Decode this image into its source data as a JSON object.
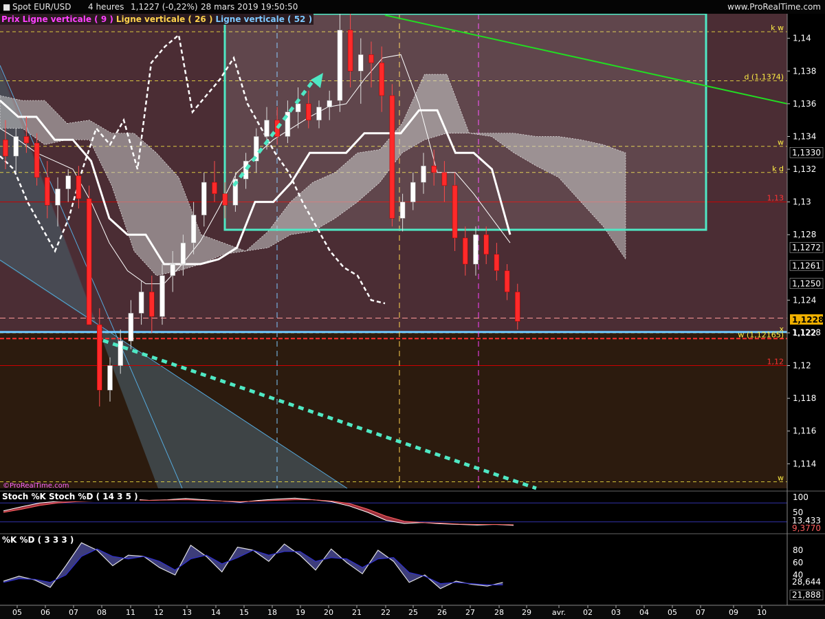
{
  "header": {
    "symbol": "Spot EUR/USD",
    "period": "4 heures",
    "last": "1,1227 (-0,22%)",
    "datetime": "28 mars 2019 19:50:50",
    "site": "www.ProRealTime.com"
  },
  "legend": {
    "price": "Prix",
    "line9": "Ligne verticale ( 9 )",
    "line26": "Ligne verticale ( 26 )",
    "line52": "Ligne verticale ( 52 )",
    "colors": {
      "price": "#ff40ff",
      "line9": "#ff40ff",
      "line26": "#ffd24d",
      "line52": "#7ec8ff"
    }
  },
  "watermark": "©ProRealTime.com",
  "colors": {
    "upCandle": "#ffffff",
    "downCandle": "#ff2a2a",
    "cloud": "#c8c8c8",
    "kijun": "#ffffff",
    "chikou": "#ffffff",
    "box": "#4fe8c4",
    "trendGreen": "#22dd22",
    "trendDotted": "#4fe8c4",
    "channel": "#55aadd",
    "support": "#6fc8ff",
    "resistanceRed": "#cc0000",
    "yellowDash": "#ffee44"
  },
  "chart_data": [
    {
      "type": "line",
      "panel": "price",
      "title": "Spot EUR/USD 4 heures",
      "x_ticks": [
        "05",
        "06",
        "07",
        "08",
        "11",
        "12",
        "13",
        "14",
        "15",
        "18",
        "19",
        "20",
        "21",
        "22",
        "25",
        "26",
        "27",
        "28",
        "29",
        "avr.",
        "02",
        "03",
        "04",
        "05",
        "07",
        "09",
        "10"
      ],
      "y_ticks": [
        "1,14",
        "1,138",
        "1,136",
        "1,134",
        "1,132",
        "1,13",
        "1,128",
        "1,124",
        "1,122",
        "1,12",
        "1,118",
        "1,116",
        "1,114"
      ],
      "ylim": [
        1.1125,
        1.1415
      ],
      "price_tags": [
        "1,1330",
        "1,1272",
        "1,1261",
        "1,1250",
        "1,1228",
        "1,1228"
      ],
      "last_price": "1,1228",
      "level_labels": [
        {
          "text": "k w",
          "value": 1.1404,
          "color": "#ffee44"
        },
        {
          "text": "d (1,1374)",
          "value": 1.1374,
          "color": "#ffee44"
        },
        {
          "text": "w",
          "value": 1.1334,
          "color": "#ffee44"
        },
        {
          "text": "k d",
          "value": 1.1318,
          "color": "#ffee44"
        },
        {
          "text": "1,13",
          "value": 1.13,
          "color": "#ff3333"
        },
        {
          "text": "x",
          "value": 1.122,
          "color": "#ffee44"
        },
        {
          "text": "w (1,12165)",
          "value": 1.12165,
          "color": "#ffee44"
        },
        {
          "text": "1,12",
          "value": 1.12,
          "color": "#ff3333"
        },
        {
          "text": "w",
          "value": 1.1129,
          "color": "#ffee44"
        }
      ],
      "vertical_lines": [
        {
          "name": "Ligne verticale ( 9 )",
          "x": "27 (late)",
          "color": "#ff40ff"
        },
        {
          "name": "Ligne verticale ( 26 )",
          "x": "22 (late)",
          "color": "#ffd24d"
        },
        {
          "name": "Ligne verticale ( 52 )",
          "x": "18",
          "color": "#7ec8ff"
        }
      ],
      "candles": [
        [
          1.1338,
          1.135,
          1.132,
          1.1328
        ],
        [
          1.1328,
          1.1345,
          1.1318,
          1.134
        ],
        [
          1.134,
          1.1352,
          1.133,
          1.1336
        ],
        [
          1.1336,
          1.1342,
          1.131,
          1.1315
        ],
        [
          1.1315,
          1.1325,
          1.129,
          1.1298
        ],
        [
          1.1298,
          1.1315,
          1.1285,
          1.1308
        ],
        [
          1.1308,
          1.132,
          1.13,
          1.1316
        ],
        [
          1.1316,
          1.1322,
          1.1296,
          1.1302
        ],
        [
          1.1302,
          1.131,
          1.124,
          1.1225
        ],
        [
          1.1225,
          1.1235,
          1.1175,
          1.1185
        ],
        [
          1.1185,
          1.1205,
          1.1178,
          1.12
        ],
        [
          1.12,
          1.1222,
          1.1195,
          1.1215
        ],
        [
          1.1215,
          1.124,
          1.121,
          1.1232
        ],
        [
          1.1232,
          1.1252,
          1.1225,
          1.1245
        ],
        [
          1.1245,
          1.1255,
          1.122,
          1.123
        ],
        [
          1.123,
          1.1262,
          1.1225,
          1.1255
        ],
        [
          1.1255,
          1.127,
          1.1245,
          1.1262
        ],
        [
          1.1262,
          1.128,
          1.1255,
          1.1275
        ],
        [
          1.1275,
          1.13,
          1.1268,
          1.1292
        ],
        [
          1.1292,
          1.1318,
          1.1285,
          1.1312
        ],
        [
          1.1312,
          1.1325,
          1.13,
          1.1305
        ],
        [
          1.1305,
          1.1312,
          1.129,
          1.1298
        ],
        [
          1.1298,
          1.1318,
          1.1294,
          1.1314
        ],
        [
          1.1314,
          1.133,
          1.1308,
          1.1325
        ],
        [
          1.1325,
          1.1345,
          1.1318,
          1.134
        ],
        [
          1.134,
          1.1358,
          1.1332,
          1.135
        ],
        [
          1.135,
          1.1358,
          1.1335,
          1.134
        ],
        [
          1.134,
          1.1362,
          1.1336,
          1.1355
        ],
        [
          1.1355,
          1.137,
          1.1345,
          1.136
        ],
        [
          1.136,
          1.1368,
          1.1345,
          1.135
        ],
        [
          1.135,
          1.1362,
          1.1345,
          1.1358
        ],
        [
          1.1358,
          1.1368,
          1.135,
          1.1362
        ],
        [
          1.1362,
          1.1418,
          1.1355,
          1.1405
        ],
        [
          1.1405,
          1.142,
          1.137,
          1.138
        ],
        [
          1.138,
          1.14,
          1.136,
          1.139
        ],
        [
          1.139,
          1.1398,
          1.137,
          1.1385
        ],
        [
          1.1385,
          1.1395,
          1.1355,
          1.1365
        ],
        [
          1.1365,
          1.1372,
          1.1285,
          1.129
        ],
        [
          1.129,
          1.1305,
          1.1282,
          1.13
        ],
        [
          1.13,
          1.1318,
          1.1295,
          1.1312
        ],
        [
          1.1312,
          1.133,
          1.1305,
          1.1322
        ],
        [
          1.1322,
          1.1332,
          1.131,
          1.1318
        ],
        [
          1.1318,
          1.1325,
          1.13,
          1.131
        ],
        [
          1.131,
          1.1318,
          1.127,
          1.1278
        ],
        [
          1.1278,
          1.1285,
          1.1255,
          1.1262
        ],
        [
          1.1262,
          1.1285,
          1.1255,
          1.128
        ],
        [
          1.128,
          1.1285,
          1.1262,
          1.1268
        ],
        [
          1.1268,
          1.1275,
          1.1252,
          1.1258
        ],
        [
          1.1258,
          1.1262,
          1.124,
          1.1245
        ],
        [
          1.1245,
          1.125,
          1.1222,
          1.1227
        ]
      ],
      "ichimoku": {
        "kijun": [
          1.1362,
          1.1352,
          1.1352,
          1.1338,
          1.1338,
          1.1325,
          1.129,
          1.128,
          1.128,
          1.1262,
          1.1262,
          1.1262,
          1.1265,
          1.1272,
          1.13,
          1.13,
          1.1312,
          1.133,
          1.133,
          1.133,
          1.1342,
          1.1342,
          1.1342,
          1.1356,
          1.1356,
          1.133,
          1.133,
          1.132,
          1.128
        ],
        "tenkan": [
          1.1345,
          1.1338,
          1.133,
          1.1325,
          1.132,
          1.13,
          1.1275,
          1.1258,
          1.125,
          1.125,
          1.1262,
          1.1276,
          1.1296,
          1.1318,
          1.1328,
          1.1338,
          1.1345,
          1.1352,
          1.1358,
          1.136,
          1.1375,
          1.1388,
          1.139,
          1.136,
          1.1318,
          1.1318,
          1.1305,
          1.129,
          1.1275
        ],
        "chikou": [
          1.1328,
          1.132,
          1.13,
          1.1285,
          1.127,
          1.129,
          1.132,
          1.1345,
          1.1335,
          1.135,
          1.132,
          1.1385,
          1.1395,
          1.1402,
          1.1355,
          1.1365,
          1.1375,
          1.1388,
          1.136,
          1.1345,
          1.133,
          1.1318,
          1.13,
          1.1285,
          1.127,
          1.126,
          1.1255,
          1.124,
          1.1238
        ],
        "cloud_top": [
          1.1365,
          1.1362,
          1.1362,
          1.1348,
          1.135,
          1.1342,
          1.1342,
          1.133,
          1.1315,
          1.128,
          1.1275,
          1.127,
          1.1282,
          1.13,
          1.1312,
          1.1318,
          1.133,
          1.1332,
          1.1348,
          1.1378,
          1.1378,
          1.1342,
          1.1342,
          1.1342,
          1.134,
          1.134,
          1.1338,
          1.1335,
          1.133
        ],
        "cloud_bottom": [
          1.1345,
          1.1345,
          1.1335,
          1.1338,
          1.1338,
          1.131,
          1.127,
          1.1255,
          1.1258,
          1.1262,
          1.1268,
          1.127,
          1.1272,
          1.128,
          1.1282,
          1.129,
          1.13,
          1.1312,
          1.133,
          1.1338,
          1.1342,
          1.1342,
          1.134,
          1.133,
          1.1322,
          1.1315,
          1.13,
          1.1285,
          1.1265
        ]
      }
    },
    {
      "type": "line",
      "panel": "stochastic_long",
      "legend": "Stoch %K  Stoch %D ( 14 3 5 )",
      "y_ticks": [
        "100",
        "50"
      ],
      "ylim": [
        0,
        100
      ],
      "value_tags": [
        "13,433",
        "9,3770"
      ],
      "series": [
        {
          "name": "Stoch %K",
          "values": [
            55,
            68,
            80,
            85,
            88,
            86,
            90,
            92,
            88,
            90,
            94,
            90,
            86,
            82,
            88,
            92,
            95,
            90,
            84,
            70,
            50,
            25,
            15,
            18,
            14,
            12,
            10,
            12,
            9
          ]
        },
        {
          "name": "Stoch %D",
          "values": [
            50,
            60,
            72,
            80,
            84,
            86,
            88,
            89,
            88,
            89,
            90,
            88,
            86,
            84,
            86,
            88,
            90,
            90,
            86,
            78,
            60,
            38,
            22,
            18,
            16,
            13,
            12,
            12,
            11
          ]
        }
      ]
    },
    {
      "type": "line",
      "panel": "stochastic_short",
      "legend": "%K  %D ( 3 3 3 )",
      "y_ticks": [
        "80",
        "60",
        "40"
      ],
      "ylim": [
        0,
        100
      ],
      "value_tags": [
        "28,644",
        "21,888"
      ],
      "series": [
        {
          "name": "%K",
          "values": [
            30,
            38,
            32,
            20,
            55,
            92,
            80,
            55,
            72,
            70,
            52,
            40,
            88,
            70,
            45,
            85,
            80,
            62,
            90,
            72,
            48,
            82,
            60,
            42,
            80,
            62,
            28,
            40,
            18,
            30,
            25,
            22,
            28
          ]
        },
        {
          "name": "%D",
          "values": [
            28,
            34,
            33,
            28,
            40,
            70,
            82,
            70,
            66,
            70,
            62,
            48,
            66,
            72,
            58,
            68,
            80,
            72,
            78,
            78,
            62,
            68,
            66,
            52,
            66,
            68,
            44,
            38,
            26,
            28,
            26,
            24,
            24
          ]
        }
      ]
    }
  ]
}
